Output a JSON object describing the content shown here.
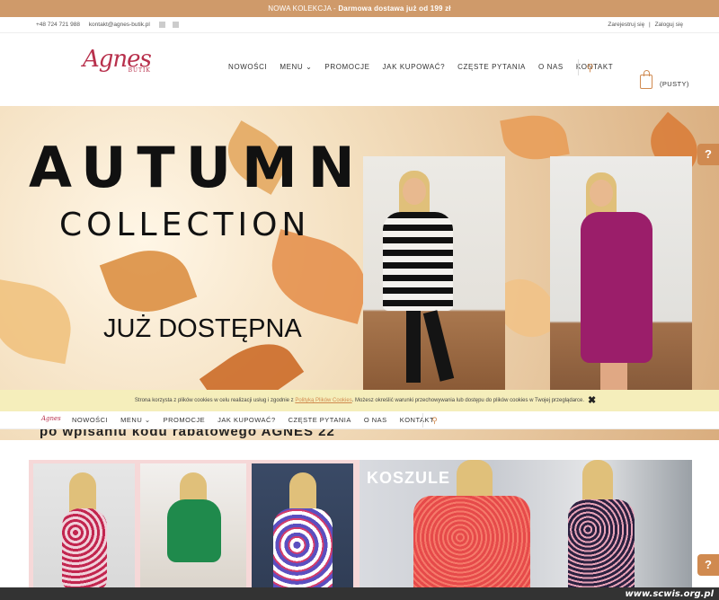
{
  "topbar": {
    "prefix": "NOWA KOLEKCJA - ",
    "highlight": "Darmowa dostawa już od 199 zł"
  },
  "contact": {
    "phone": "+48 724 721 988",
    "email": "kontakt@agnes-butik.pl"
  },
  "account": {
    "register": "Zarejestruj się",
    "separator": "|",
    "login": "Zaloguj się"
  },
  "logo": {
    "name": "Agnes",
    "tagline": "BUTIK"
  },
  "nav": {
    "items": [
      "NOWOŚCI",
      "MENU ⌄",
      "PROMOCJE",
      "JAK KUPOWAĆ?",
      "CZĘSTE PYTANIA",
      "O NAS",
      "KONTAKT"
    ]
  },
  "cart": {
    "label": "(PUSTY)"
  },
  "hero": {
    "title": "AUTUMN",
    "subtitle": "COLLECTION",
    "available": "JUŻ DOSTĘPNA",
    "promo": "po wpisaniu kodu rabatowego AGNES 22"
  },
  "cookie": {
    "text_before": "Strona korzysta z plików cookies w celu realizacji usług i zgodnie z ",
    "link": "Polityką Plików Cookies",
    "text_after": ". Możesz określić warunki przechowywania lub dostępu do plików cookies w Twojej przeglądarce.",
    "close": "✖"
  },
  "sticky_nav": {
    "items": [
      "NOWOŚCI",
      "MENU ⌄",
      "PROMOCJE",
      "JAK KUPOWAĆ?",
      "CZĘSTE PYTANIA",
      "O NAS",
      "KONTAKT"
    ]
  },
  "category": {
    "title": "KOSZULE"
  },
  "help": {
    "glyph": "?"
  },
  "watermark": "www.scwis.org.pl",
  "colors": {
    "accent": "#d08a50",
    "topbar": "#cf9a6a",
    "logo": "#b8304c",
    "cookie_bg": "#f5eebb"
  }
}
